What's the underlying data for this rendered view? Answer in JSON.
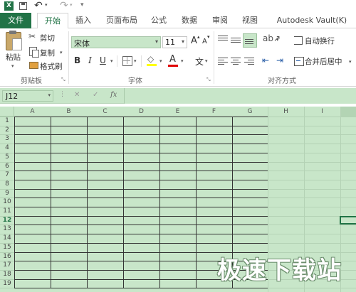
{
  "titlebar": {
    "app_icon": "excel-icon",
    "save_icon": "save-icon",
    "undo": "↶",
    "redo": "↷",
    "customize": "▾"
  },
  "tabs": [
    {
      "label": "文件"
    },
    {
      "label": "开始"
    },
    {
      "label": "插入"
    },
    {
      "label": "页面布局"
    },
    {
      "label": "公式"
    },
    {
      "label": "数据"
    },
    {
      "label": "审阅"
    },
    {
      "label": "视图"
    },
    {
      "label": "Autodesk Vault(K)"
    }
  ],
  "clipboard": {
    "paste": "粘贴",
    "cut": "剪切",
    "copy": "复制",
    "format_painter": "格式刷",
    "group": "剪贴板"
  },
  "font": {
    "name": "宋体",
    "size": "11",
    "bold": "B",
    "italic": "I",
    "underline": "U",
    "grow": "A",
    "shrink": "A",
    "group": "字体",
    "font_color": "A",
    "phonetic": "文"
  },
  "alignment": {
    "wrap": "自动换行",
    "merge": "合并后居中",
    "group": "对齐方式"
  },
  "formula_bar": {
    "name_box": "J12",
    "cancel": "✕",
    "enter": "✓",
    "fx": "fx",
    "value": ""
  },
  "columns": [
    "A",
    "B",
    "C",
    "D",
    "E",
    "F",
    "G",
    "H",
    "I"
  ],
  "rows": [
    "1",
    "2",
    "3",
    "4",
    "5",
    "6",
    "7",
    "8",
    "9",
    "10",
    "11",
    "12",
    "13",
    "14",
    "15",
    "16",
    "17",
    "18",
    "19"
  ],
  "watermark": "极速下载站",
  "colors": {
    "accent": "#217346",
    "grid_bg": "#c8e6c9"
  }
}
